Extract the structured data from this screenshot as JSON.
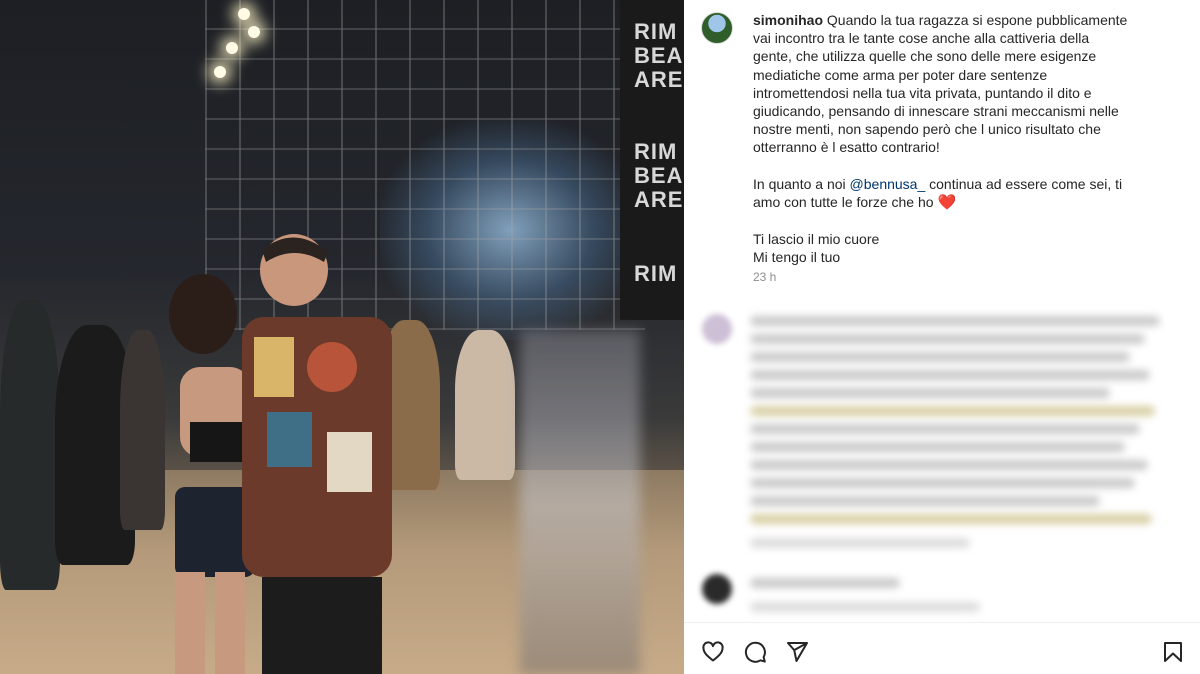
{
  "post": {
    "username": "simonihao",
    "caption_lines": [
      "Quando la tua ragazza si espone pubblicamente",
      "vai incontro tra le tante cose anche alla cattiveria della",
      "gente, che utilizza quelle che sono delle mere esigenze",
      "mediatiche come arma per poter dare sentenze",
      "intromettendosi nella tua vita privata, puntando il dito e",
      "giudicando, pensando di innescare strani meccanismi nelle",
      "nostre menti, non sapendo però che l unico risultato che",
      "otterranno è l esatto contrario!"
    ],
    "second_paragraph_prefix": "In quanto a noi ",
    "mention": "@bennusa_",
    "second_paragraph_suffix": " continua ad essere come sei, ti",
    "second_paragraph_line2": "amo con tutte le forze che ho",
    "heart_emoji": "❤️",
    "closing_lines": [
      "Ti lascio il mio cuore",
      "Mi tengo il tuo"
    ],
    "timestamp": "23 h"
  },
  "photo": {
    "banner_text": [
      "RIM",
      "BEA",
      "ARE",
      "RIM",
      "BEA",
      "ARE",
      "RIM"
    ]
  },
  "colors": {
    "mention": "#00376b",
    "heart": "#e0245e",
    "text": "#262626",
    "muted": "#8e8e8e"
  },
  "icons": {
    "like": "heart-icon",
    "comment": "comment-icon",
    "share": "send-icon",
    "save": "bookmark-icon"
  }
}
